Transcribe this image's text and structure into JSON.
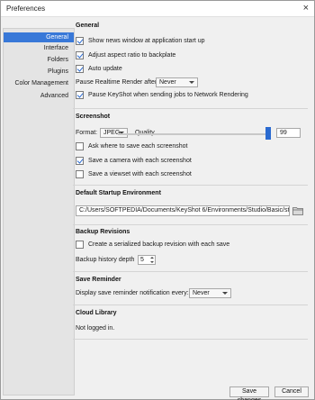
{
  "window": {
    "title": "Preferences",
    "close_glyph": "×"
  },
  "sidebar": {
    "items": [
      {
        "label": "General"
      },
      {
        "label": "Interface"
      },
      {
        "label": "Folders"
      },
      {
        "label": "Plugins"
      },
      {
        "label": "Color Management"
      },
      {
        "label": "Advanced"
      }
    ]
  },
  "general": {
    "title": "General",
    "options": [
      {
        "label": "Show news window at application start up",
        "checked": true
      },
      {
        "label": "Adjust aspect ratio to backplate",
        "checked": true
      },
      {
        "label": "Auto update",
        "checked": true
      }
    ],
    "pause_label": "Pause Realtime Render after:",
    "pause_value": "Never",
    "pause_keyshot": {
      "label": "Pause KeyShot when sending jobs to Network Rendering",
      "checked": true
    }
  },
  "screenshot": {
    "title": "Screenshot",
    "format_label": "Format:",
    "format_value": "JPEG",
    "quality_label": "Quality",
    "quality_value": "99",
    "options": [
      {
        "label": "Ask where to save each screenshot",
        "checked": false
      },
      {
        "label": "Save a camera with each screenshot",
        "checked": true
      },
      {
        "label": "Save a viewset with each screenshot",
        "checked": false
      }
    ]
  },
  "startup": {
    "title": "Default Startup Environment",
    "path": "C:/Users/SOFTPEDIA/Documents/KeyShot 6/Environments/Studio/Basic/startup"
  },
  "backup": {
    "title": "Backup Revisions",
    "create_label": "Create a serialized backup revision with each save",
    "create_checked": false,
    "depth_label": "Backup history depth",
    "depth_value": "5"
  },
  "reminder": {
    "title": "Save Reminder",
    "label": "Display save reminder notification every:",
    "value": "Never"
  },
  "cloud": {
    "title": "Cloud Library",
    "status": "Not logged in."
  },
  "footer": {
    "save_label": "Save changes",
    "cancel_label": "Cancel"
  }
}
